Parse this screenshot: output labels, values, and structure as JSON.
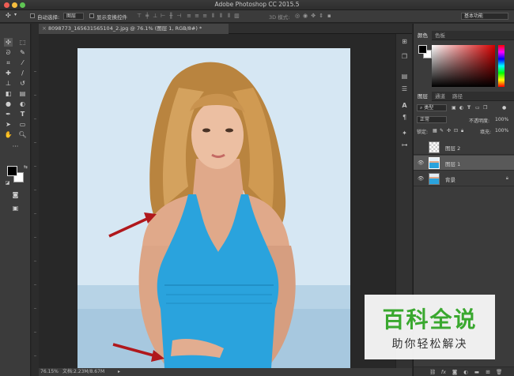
{
  "window": {
    "title": "Adobe Photoshop CC 2015.5"
  },
  "options_bar": {
    "auto_select_label": "自动选择:",
    "auto_select_value": "图层",
    "show_transform_label": "显示变换控件",
    "mode_3d_label": "3D 模式:",
    "workspace": "基本功能"
  },
  "document": {
    "tab_title": "8098773_165631565104_2.jpg @ 76.1% (图层 1, RGB/8#) *"
  },
  "status": {
    "zoom": "76.15%",
    "doc_size": "文档:2.23M/8.67M"
  },
  "panels": {
    "color_tabs": [
      "颜色",
      "色板"
    ],
    "layer_tabs": [
      "图层",
      "通道",
      "路径"
    ],
    "filter_kind": "类型",
    "blend_mode": "正常",
    "opacity_label": "不透明度:",
    "opacity_value": "100%",
    "lock_label": "锁定:",
    "fill_label": "填充:",
    "fill_value": "100%",
    "layers": [
      {
        "name": "图层 2",
        "visible": false,
        "selected": false
      },
      {
        "name": "图层 1",
        "visible": true,
        "selected": true
      },
      {
        "name": "背景",
        "visible": true,
        "selected": false,
        "locked": true
      }
    ]
  },
  "watermark": {
    "title": "百科全说",
    "subtitle": "助你轻松解决"
  },
  "colors": {
    "accent_red": "#b0181c",
    "swimsuit": "#2aa3dd",
    "watermark_green": "#3aa82f"
  }
}
